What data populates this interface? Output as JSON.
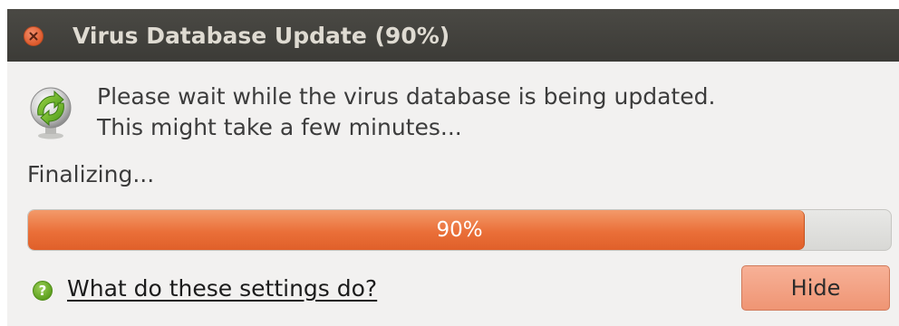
{
  "window": {
    "title": "Virus Database Update (90%)"
  },
  "message": {
    "line1": "Please wait while the virus database is being updated.",
    "line2": "This might take a few minutes..."
  },
  "status": "Finalizing...",
  "progress": {
    "value": 0.9,
    "label": "90%"
  },
  "help": {
    "icon": "help-icon",
    "link_label": "What do these settings do?"
  },
  "buttons": {
    "hide_label": "Hide"
  },
  "colors": {
    "titlebar": "#3c3b37",
    "close": "#df5a2c",
    "progress_fill": "#ea6f38",
    "button": "#ef9574",
    "help_icon": "#5a9e1c"
  },
  "icons": {
    "close": "close-icon",
    "update": "sync-icon"
  }
}
